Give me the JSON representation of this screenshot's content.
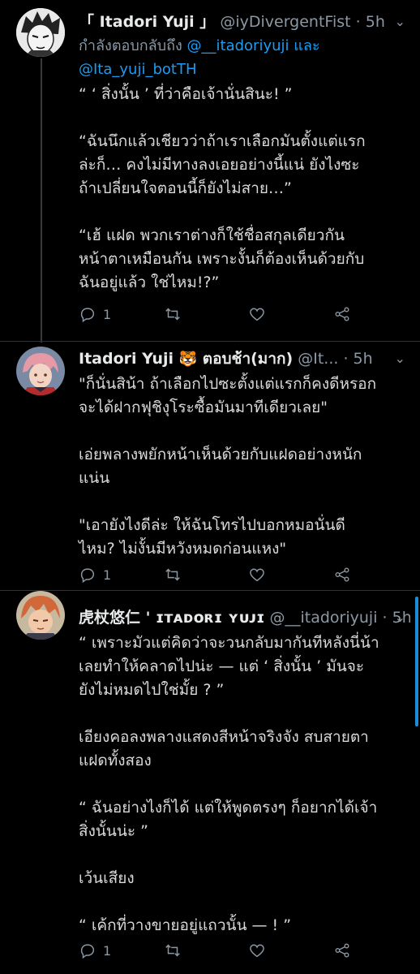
{
  "tweets": [
    {
      "name": "「 Itadori Yuji 」",
      "handle": "@iyDivergentFist",
      "time": "5h",
      "reply_prefix": "กำลังตอบกลับถึง",
      "reply_mention_1": "@__itadoriyuji",
      "reply_and": "และ",
      "reply_mention_2": "@Ita_yuji_botTH",
      "body": "“ ‘ สิ่งนั้น ’ ที่ว่าคือเจ้านั่นสินะ! ”\n\n“ฉันนึกแล้วเชียวว่าถ้าเราเลือกมันตั้งแต่แรก\nล่ะก็… คงไม่มีทางลงเอยอย่างนี้แน่ ยังไงซะ\nถ้าเปลี่ยนใจตอนนี้ก็ยังไม่สาย…”\n\n“เฮ้ แฝด พวกเราต่างก็ใช้ชื่อสกุลเดียวกัน\nหน้าตาเหมือนกัน เพราะงั้นก็ต้องเห็นด้วยกับ\nฉันอยู่แล้ว ใช่ไหม!?”",
      "reply_count": "1"
    },
    {
      "name": "Itadori Yuji",
      "emoji": "🐯",
      "name_suffix": "ตอบช้า(มาก)",
      "handle": "@It...",
      "time": "5h",
      "body": "\"ก็นั่นสิน้า ถ้าเลือกไปซะตั้งแต่แรกก็คงดีหรอก\nจะได้ฝากฟุชิงุโระซื้อมันมาทีเดียวเลย\"\n\nเอ่ยพลางพยักหน้าเห็นด้วยกับแฝดอย่างหนัก\nแน่น\n\n\"เอายังไงดีล่ะ ให้ฉันโทรไปบอกหมอนั่นดี\nไหม? ไม่งั้นมีหวังหมดก่อนแหง\"",
      "reply_count": "1"
    },
    {
      "name": "虎杖悠仁 ' ɪᴛᴀᴅᴏʀɪ ʏᴜᴊɪ",
      "handle": "@__itadoriyuji",
      "time": "5h",
      "body": "“ เพราะมัวแต่คิดว่าจะวนกลับมากันทีหลังนี่น้า\nเลยทำให้คลาดไปน่ะ — แต่ ‘ สิ่งนั้น ’ มันจะ\nยังไม่หมดไปใช่มั้ย ? ”\n\nเอียงคอลงพลางแสดงสีหน้าจริงจัง สบสายตา\nแฝดทั้งสอง\n\n“ ฉันอย่างไงก็ได้ แต่ให้พูดตรงๆ ก็อยากได้เจ้า\nสิ่งนั้นน่ะ ”\n\nเว้นเสียง\n\n“ เค้กที่วางขายอยู่แถวนั้น — ! ”",
      "reply_count": "1"
    }
  ],
  "separator": "·",
  "colors": {
    "background": "#000000",
    "accent": "#1d9bf0",
    "muted": "#8b98a5",
    "text": "#d9d9d9"
  }
}
